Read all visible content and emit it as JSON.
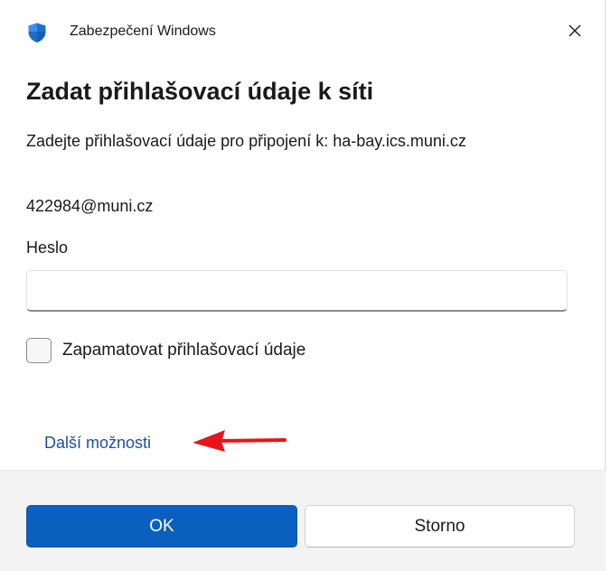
{
  "window": {
    "app_title": "Zabezpečení Windows",
    "icon": "windows-security-shield-icon",
    "close_icon": "close-icon"
  },
  "dialog": {
    "heading": "Zadat přihlašovací údaje k síti",
    "subtitle": "Zadejte přihlašovací údaje pro připojení k: ha-bay.ics.muni.cz",
    "username": "422984@muni.cz",
    "password_label": "Heslo",
    "password_value": "",
    "remember_label": "Zapamatovat přihlašovací údaje",
    "remember_checked": false,
    "more_options_label": "Další možnosti"
  },
  "footer": {
    "ok_label": "OK",
    "cancel_label": "Storno"
  },
  "annotation": {
    "arrow": "red-arrow-pointing-left",
    "color": "#e8141a"
  },
  "colors": {
    "accent": "#0a5fbf",
    "link": "#1f4e9c",
    "footer_bg": "#f3f3f3"
  }
}
